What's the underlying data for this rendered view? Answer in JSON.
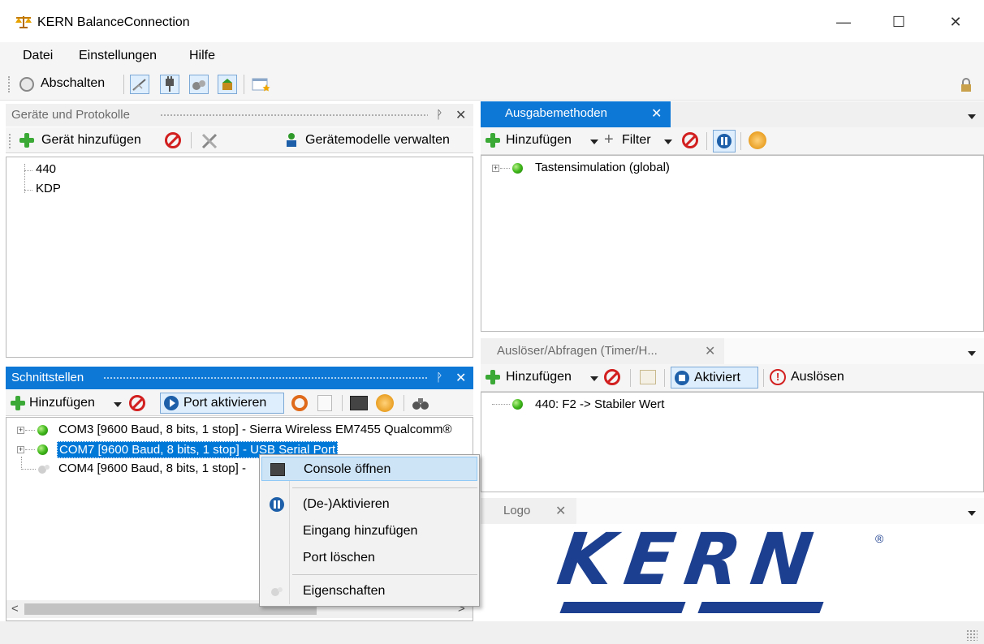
{
  "window": {
    "title": "KERN BalanceConnection",
    "minimize": "—",
    "maximize": "☐",
    "close": "✕"
  },
  "menu": {
    "items": [
      "Datei",
      "Einstellungen",
      "Hilfe"
    ]
  },
  "toolbar": {
    "shutdown_label": "Abschalten"
  },
  "devices_panel": {
    "title": "Geräte und Protokolle",
    "add_device": "Gerät hinzufügen",
    "manage_models": "Gerätemodelle verwalten",
    "pin": "ᚹ",
    "close": "✕",
    "items": [
      "440",
      "KDP"
    ]
  },
  "interfaces_panel": {
    "title": "Schnittstellen",
    "add": "Hinzufügen",
    "activate_port": "Port aktivieren",
    "pin": "ᚹ",
    "close": "✕",
    "ports": [
      "COM3 [9600 Baud, 8 bits, 1 stop] - Sierra Wireless EM7455 Qualcomm®",
      "COM7 [9600 Baud, 8 bits, 1 stop] - USB Serial Port",
      "COM4 [9600 Baud, 8 bits, 1 stop] -"
    ],
    "scroll_left": "<",
    "scroll_right": ">"
  },
  "output_panel": {
    "tab": "Ausgabemethoden",
    "close": "✕",
    "add": "Hinzufügen",
    "filter": "Filter",
    "items": [
      "Tastensimulation (global)"
    ]
  },
  "trigger_panel": {
    "tab": "Auslöser/Abfragen (Timer/H...",
    "close": "✕",
    "add": "Hinzufügen",
    "activated": "Aktiviert",
    "trigger": "Auslösen",
    "items": [
      "440: F2 -> Stabiler Wert"
    ]
  },
  "logo_panel": {
    "tab": "Logo",
    "close": "✕",
    "logo_text": "KERN",
    "reg": "®"
  },
  "context_menu": {
    "items": [
      "Console öffnen",
      "(De-)Aktivieren",
      "Eingang hinzufügen",
      "Port löschen",
      "Eigenschaften"
    ]
  },
  "colors": {
    "accent": "#0e78d7",
    "selection": "#0078d7",
    "kern_blue": "#1d3f8f",
    "green": "#3aa935",
    "red": "#d21f1f"
  }
}
